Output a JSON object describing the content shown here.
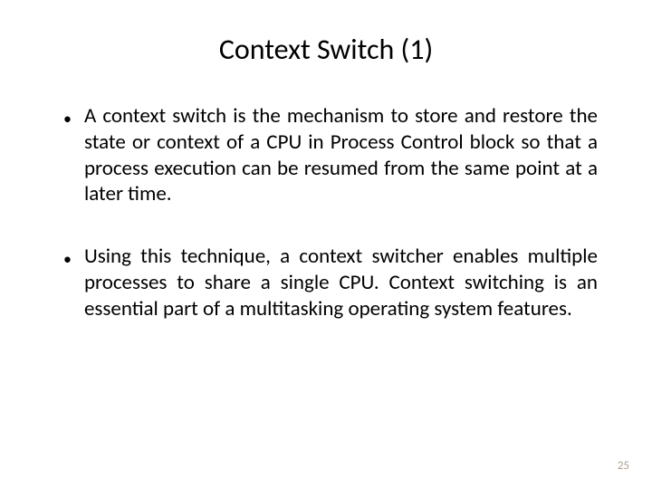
{
  "slide": {
    "title": "Context Switch (1)",
    "bullets": [
      "A context switch is the mechanism to store and restore the state or context of a CPU in Process Control block so that a process execution can be resumed from the same point at a later time.",
      " Using this technique, a context switcher enables multiple processes to share a single CPU. Context switching is an essential part of a multitasking operating system features."
    ],
    "page_number": "25"
  }
}
